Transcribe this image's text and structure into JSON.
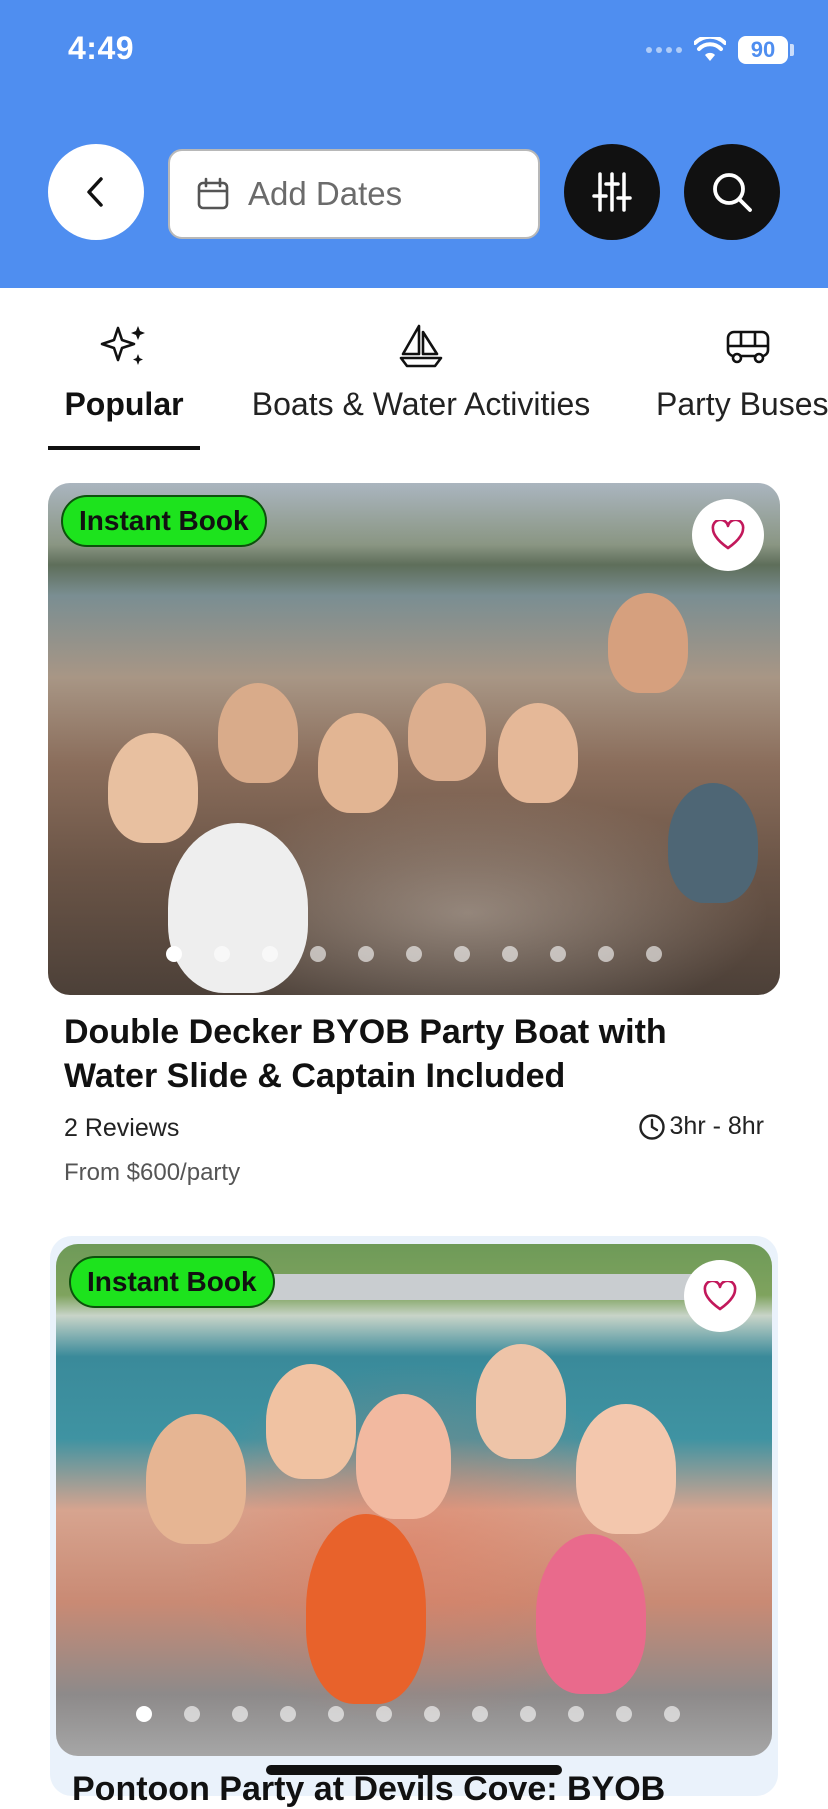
{
  "status_bar": {
    "time": "4:49",
    "battery": "90",
    "icons": [
      "signal-dots-icon",
      "wifi-icon",
      "battery-icon"
    ]
  },
  "header": {
    "background": "#4f8ef0",
    "back_icon": "chevron-left-icon",
    "date_placeholder": "Add Dates",
    "date_icon": "calendar-icon",
    "filter_icon": "sliders-icon",
    "search_icon": "search-icon"
  },
  "tabs": [
    {
      "label": "Popular",
      "icon": "sparkles-icon",
      "active": true
    },
    {
      "label": "Boats & Water Activities",
      "icon": "sailboat-icon",
      "active": false
    },
    {
      "label": "Party Buses",
      "icon": "bus-icon",
      "active": false
    }
  ],
  "listings": [
    {
      "badge": "Instant Book",
      "title": "Double Decker BYOB Party Boat with Water Slide & Captain Included",
      "reviews": "2 Reviews",
      "duration": "3hr - 8hr",
      "price": "From $600/party",
      "photo_count": 11,
      "active_photo": 1
    },
    {
      "badge": "Instant Book",
      "title": "Pontoon Party at Devils Cove: BYOB",
      "photo_count": 12,
      "active_photo": 1
    }
  ],
  "colors": {
    "accent": "#4f8ef0",
    "badge_green": "#1de31d",
    "heart": "#c2185b"
  }
}
